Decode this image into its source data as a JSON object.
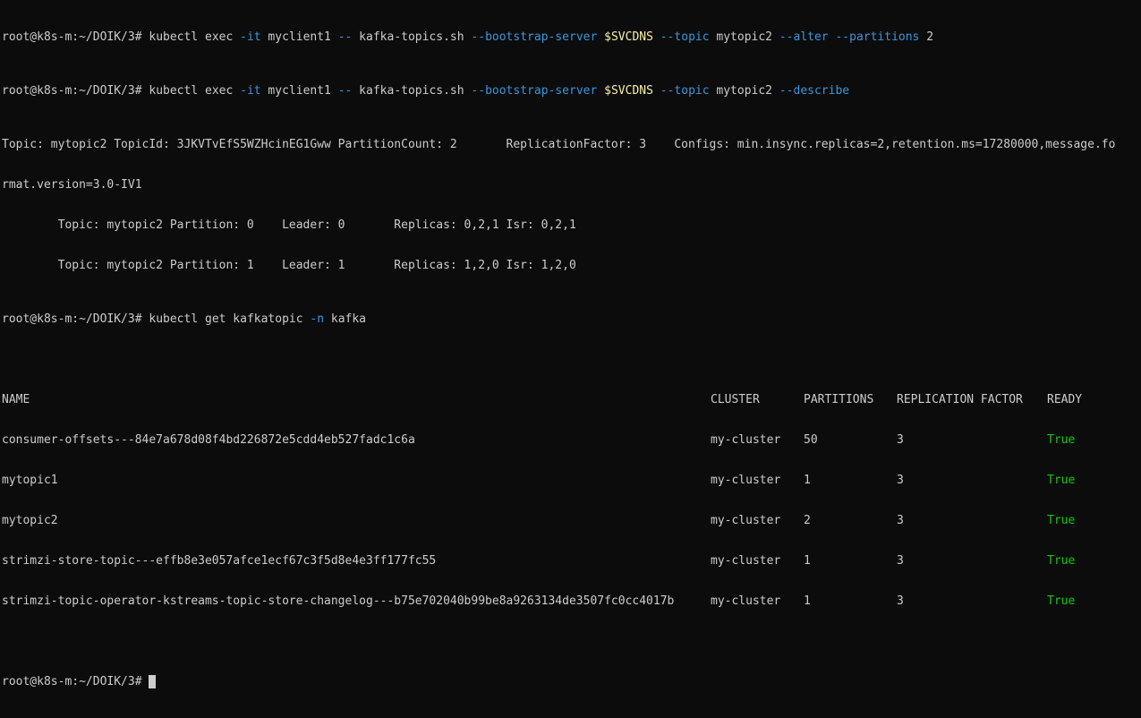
{
  "colors": {
    "background": "#0c0c0c",
    "text": "#cccccc",
    "flag": "#3a96dd",
    "variable": "#f9f1a5",
    "ready_true": "#16c60c"
  },
  "prompt": "root@k8s-m:~/DOIK/3#",
  "cmd1": {
    "t1": " kubectl exec ",
    "f1": "-it",
    "t2": " myclient1 ",
    "f2": "--",
    "t3": " kafka-topics.sh ",
    "f3": "--bootstrap-server",
    "t4": " ",
    "v1": "$SVCDNS",
    "t5": " ",
    "f4": "--topic",
    "t6": " mytopic2 ",
    "f5": "--alter",
    "t7": " ",
    "f6": "--partitions",
    "t8": " 2"
  },
  "cmd2": {
    "t1": " kubectl exec ",
    "f1": "-it",
    "t2": " myclient1 ",
    "f2": "--",
    "t3": " kafka-topics.sh ",
    "f3": "--bootstrap-server",
    "t4": " ",
    "v1": "$SVCDNS",
    "t5": " ",
    "f4": "--topic",
    "t6": " mytopic2 ",
    "f5": "--describe"
  },
  "describe_output": [
    "Topic: mytopic2 TopicId: 3JKVTvEfS5WZHcinEG1Gww PartitionCount: 2       ReplicationFactor: 3    Configs: min.insync.replicas=2,retention.ms=17280000,message.fo",
    "rmat.version=3.0-IV1",
    "        Topic: mytopic2 Partition: 0    Leader: 0       Replicas: 0,2,1 Isr: 0,2,1",
    "        Topic: mytopic2 Partition: 1    Leader: 1       Replicas: 1,2,0 Isr: 1,2,0"
  ],
  "cmd3": {
    "t1": " kubectl get kafkatopic ",
    "f1": "-n",
    "t2": " kafka"
  },
  "table": {
    "headers": [
      "NAME",
      "CLUSTER",
      "PARTITIONS",
      "REPLICATION FACTOR",
      "READY"
    ],
    "rows": [
      [
        "consumer-offsets---84e7a678d08f4bd226872e5cdd4eb527fadc1c6a",
        "my-cluster",
        "50",
        "3",
        "True"
      ],
      [
        "mytopic1",
        "my-cluster",
        "1",
        "3",
        "True"
      ],
      [
        "mytopic2",
        "my-cluster",
        "2",
        "3",
        "True"
      ],
      [
        "strimzi-store-topic---effb8e3e057afce1ecf67c3f5d8e4e3ff177fc55",
        "my-cluster",
        "1",
        "3",
        "True"
      ],
      [
        "strimzi-topic-operator-kstreams-topic-store-changelog---b75e702040b99be8a9263134de3507fc0cc4017b",
        "my-cluster",
        "1",
        "3",
        "True"
      ]
    ]
  }
}
